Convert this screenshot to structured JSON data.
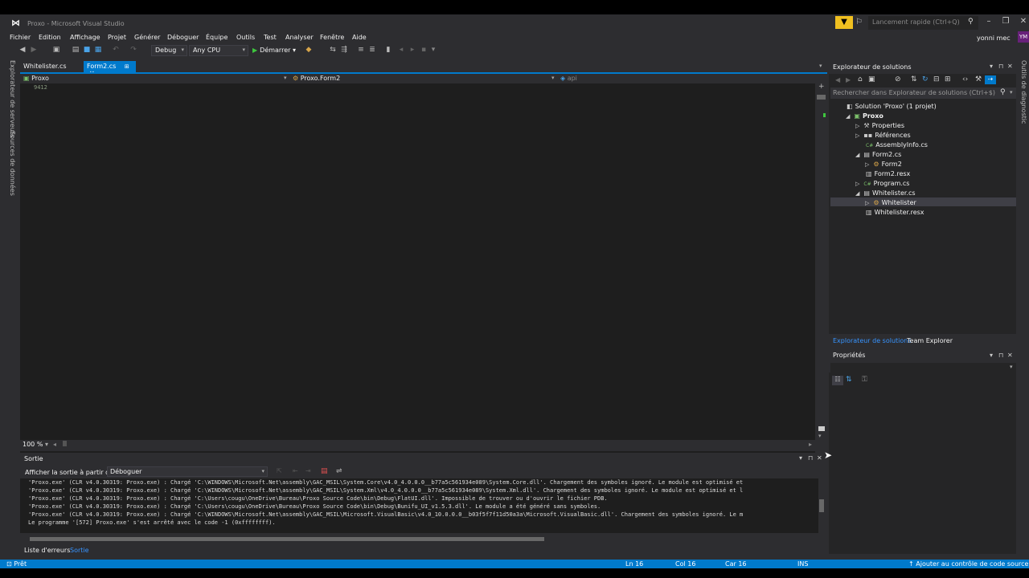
{
  "window": {
    "title": "Proxo - Microsoft Visual Studio",
    "quick_launch_placeholder": "Lancement rapide (Ctrl+Q)",
    "user_name": "yonni mec",
    "avatar_initials": "YM",
    "accent_color": "#007acc"
  },
  "menu": [
    "Fichier",
    "Edition",
    "Affichage",
    "Projet",
    "Générer",
    "Déboguer",
    "Équipe",
    "Outils",
    "Test",
    "Analyser",
    "Fenêtre",
    "Aide"
  ],
  "toolbar": {
    "configuration": "Debug",
    "platform": "Any CPU",
    "start_label": "Démarrer"
  },
  "left_tabs": [
    "Explorateur de serveurs",
    "Sources de données"
  ],
  "right_tabs": [
    "Outils de diagnostic"
  ],
  "editor": {
    "tabs": [
      {
        "label": "Whitelister.cs",
        "active": false
      },
      {
        "label": "Form2.cs",
        "active": true
      }
    ],
    "nav_project": "Proxo",
    "nav_class": "Proxo.Form2",
    "nav_member": "api",
    "code_line": "9412",
    "zoom": "100 %"
  },
  "output": {
    "title": "Sortie",
    "show_output_from_label": "Afficher la sortie à partir de :",
    "source": "Déboguer",
    "lines": [
      "'Proxo.exe' (CLR v4.0.30319: Proxo.exe) : Chargé 'C:\\WINDOWS\\Microsoft.Net\\assembly\\GAC_MSIL\\System.Core\\v4.0_4.0.0.0__b77a5c561934e089\\System.Core.dll'. Chargement des symboles ignoré. Le module est optimisé et",
      "'Proxo.exe' (CLR v4.0.30319: Proxo.exe) : Chargé 'C:\\WINDOWS\\Microsoft.Net\\assembly\\GAC_MSIL\\System.Xml\\v4.0_4.0.0.0__b77a5c561934e089\\System.Xml.dll'. Chargement des symboles ignoré. Le module est optimisé et l",
      "'Proxo.exe' (CLR v4.0.30319: Proxo.exe) : Chargé 'C:\\Users\\cougu\\OneDrive\\Bureau\\Proxo Source Code\\bin\\Debug\\FlatUI.dll'. Impossible de trouver ou d'ouvrir le fichier PDB.",
      "'Proxo.exe' (CLR v4.0.30319: Proxo.exe) : Chargé 'C:\\Users\\cougu\\OneDrive\\Bureau\\Proxo Source Code\\bin\\Debug\\Bunifu_UI_v1.5.3.dll'. Le module a été généré sans symboles.",
      "'Proxo.exe' (CLR v4.0.30319: Proxo.exe) : Chargé 'C:\\WINDOWS\\Microsoft.Net\\assembly\\GAC_MSIL\\Microsoft.VisualBasic\\v4.0_10.0.0.0__b03f5f7f11d50a3a\\Microsoft.VisualBasic.dll'. Chargement des symboles ignoré. Le m",
      "Le programme '[572] Proxo.exe' s'est arrêté avec le code -1 (0xffffffff)."
    ],
    "bottom_tabs": [
      {
        "label": "Liste d'erreurs",
        "active": false
      },
      {
        "label": "Sortie",
        "active": true
      }
    ]
  },
  "solution_explorer": {
    "title": "Explorateur de solutions",
    "search_placeholder": "Rechercher dans Explorateur de solutions (Ctrl+$)",
    "tree": [
      {
        "label": "Solution 'Proxo' (1 projet)",
        "depth": 0,
        "arrow": "",
        "icon": "solution-icon",
        "bold": false
      },
      {
        "label": "Proxo",
        "depth": 1,
        "arrow": "expanded",
        "icon": "csproj-icon",
        "bold": true
      },
      {
        "label": "Properties",
        "depth": 2,
        "arrow": "collapsed",
        "icon": "wrench-icon",
        "bold": false
      },
      {
        "label": "Références",
        "depth": 2,
        "arrow": "collapsed",
        "icon": "references-icon",
        "bold": false
      },
      {
        "label": "AssemblyInfo.cs",
        "depth": 2,
        "arrow": "",
        "icon": "csharp-file-icon",
        "bold": false
      },
      {
        "label": "Form2.cs",
        "depth": 2,
        "arrow": "expanded",
        "icon": "form-icon",
        "bold": false
      },
      {
        "label": "Form2",
        "depth": 3,
        "arrow": "collapsed",
        "icon": "class-icon",
        "bold": false
      },
      {
        "label": "Form2.resx",
        "depth": 2,
        "arrow": "",
        "icon": "resx-icon",
        "bold": false
      },
      {
        "label": "Program.cs",
        "depth": 2,
        "arrow": "collapsed",
        "icon": "csharp-file-icon",
        "bold": false
      },
      {
        "label": "Whitelister.cs",
        "depth": 2,
        "arrow": "expanded",
        "icon": "form-icon",
        "bold": false
      },
      {
        "label": "Whitelister",
        "depth": 3,
        "arrow": "collapsed",
        "icon": "class-icon",
        "bold": false
      },
      {
        "label": "Whitelister.resx",
        "depth": 2,
        "arrow": "",
        "icon": "resx-icon",
        "bold": false
      }
    ],
    "selected_index": 10,
    "bottom_tabs": [
      {
        "label": "Explorateur de solutions",
        "active": true
      },
      {
        "label": "Team Explorer",
        "active": false
      }
    ]
  },
  "properties": {
    "title": "Propriétés"
  },
  "status": {
    "ready": "Prêt",
    "line": "Ln 16",
    "col": "Col 16",
    "char": "Car 16",
    "mode": "INS",
    "source_control": "Ajouter au contrôle de code source"
  }
}
